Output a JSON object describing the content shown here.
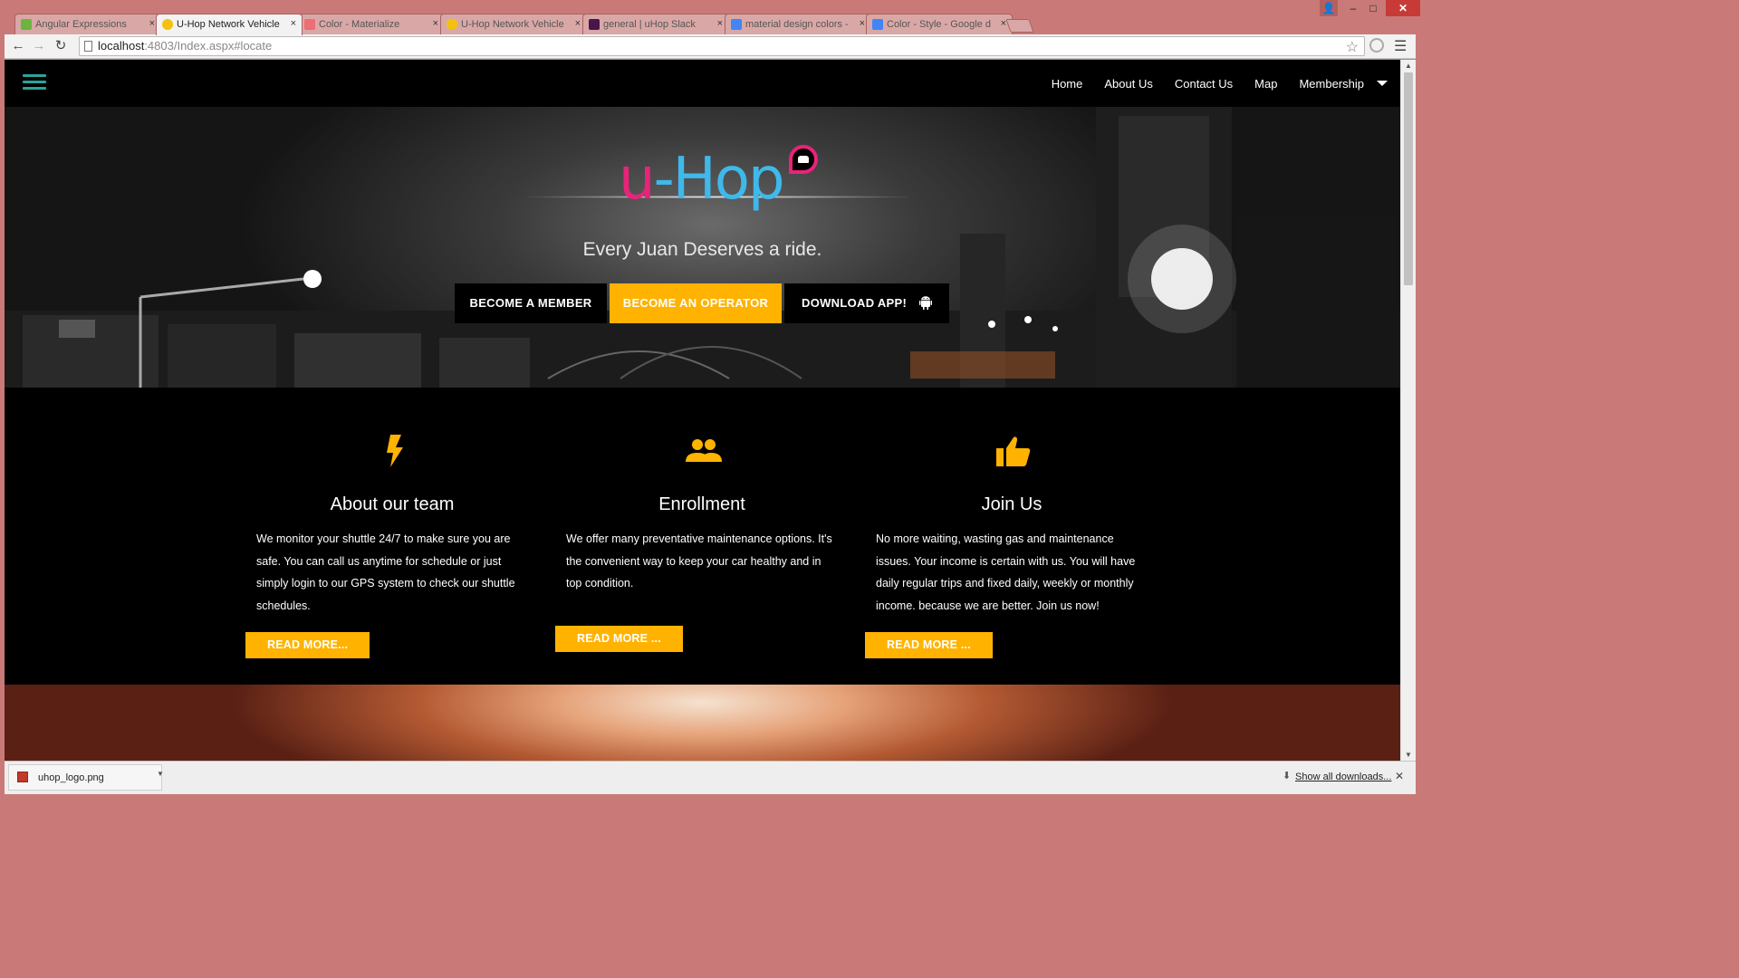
{
  "browser": {
    "tabs": [
      {
        "title": "Angular Expressions",
        "icon": "angular-favicon",
        "icon_color": "#6db33f",
        "active": false
      },
      {
        "title": "U-Hop Network Vehicle S",
        "icon": "uhop-favicon",
        "icon_color": "#f4c20d",
        "active": true
      },
      {
        "title": "Color - Materialize",
        "icon": "materialize-favicon",
        "icon_color": "#ee6e73",
        "active": false
      },
      {
        "title": "U-Hop Network Vehicle S",
        "icon": "uhop-favicon",
        "icon_color": "#f4c20d",
        "active": false
      },
      {
        "title": "general | uHop Slack",
        "icon": "slack-favicon",
        "icon_color": "#4a154b",
        "active": false
      },
      {
        "title": "material design colors - G",
        "icon": "google-favicon",
        "icon_color": "#4285f4",
        "active": false
      },
      {
        "title": "Color - Style - Google des",
        "icon": "google-favicon",
        "icon_color": "#4285f4",
        "active": false
      }
    ],
    "tab_close": "×",
    "url_host": "localhost",
    "url_rest": ":4803/Index.aspx#locate",
    "window_controls": {
      "minimize": "–",
      "maximize": "□",
      "close": "✕",
      "user": "👤"
    }
  },
  "site": {
    "nav": [
      {
        "label": "Home"
      },
      {
        "label": "About Us"
      },
      {
        "label": "Contact Us"
      },
      {
        "label": "Map"
      },
      {
        "label": "Membership"
      }
    ],
    "accent": "#26a69a",
    "amber": "#ffb300",
    "logo": {
      "u": "u",
      "dash": "-",
      "hop": "Hop",
      "pink": "#e8237a",
      "blue": "#3fb8ea"
    },
    "hero": {
      "tagline": "Every Juan Deserves a ride.",
      "buttons": {
        "member": "BECOME A MEMBER",
        "operator": "BECOME AN OPERATOR",
        "download": "DOWNLOAD APP!"
      }
    },
    "features": [
      {
        "icon": "lightning-bolt-icon",
        "title": "About our team",
        "text": "We monitor your shuttle 24/7 to make sure you are safe. You can call us anytime for schedule or just simply login to our GPS system to check our shuttle schedules.",
        "button": "READ MORE..."
      },
      {
        "icon": "people-group-icon",
        "title": "Enrollment",
        "text": "We offer many preventative maintenance options. It's the convenient way to keep your car healthy and in top condition.",
        "button": "READ MORE ..."
      },
      {
        "icon": "thumbs-up-icon",
        "title": "Join Us",
        "text": "No more waiting, wasting gas and maintenance issues. Your income is certain with us. You will have daily regular trips and fixed daily, weekly or monthly income. because we are better. Join us now!",
        "button": "READ MORE ..."
      }
    ]
  },
  "downloads": {
    "file": "uhop_logo.png",
    "show_all": "Show all downloads..."
  }
}
